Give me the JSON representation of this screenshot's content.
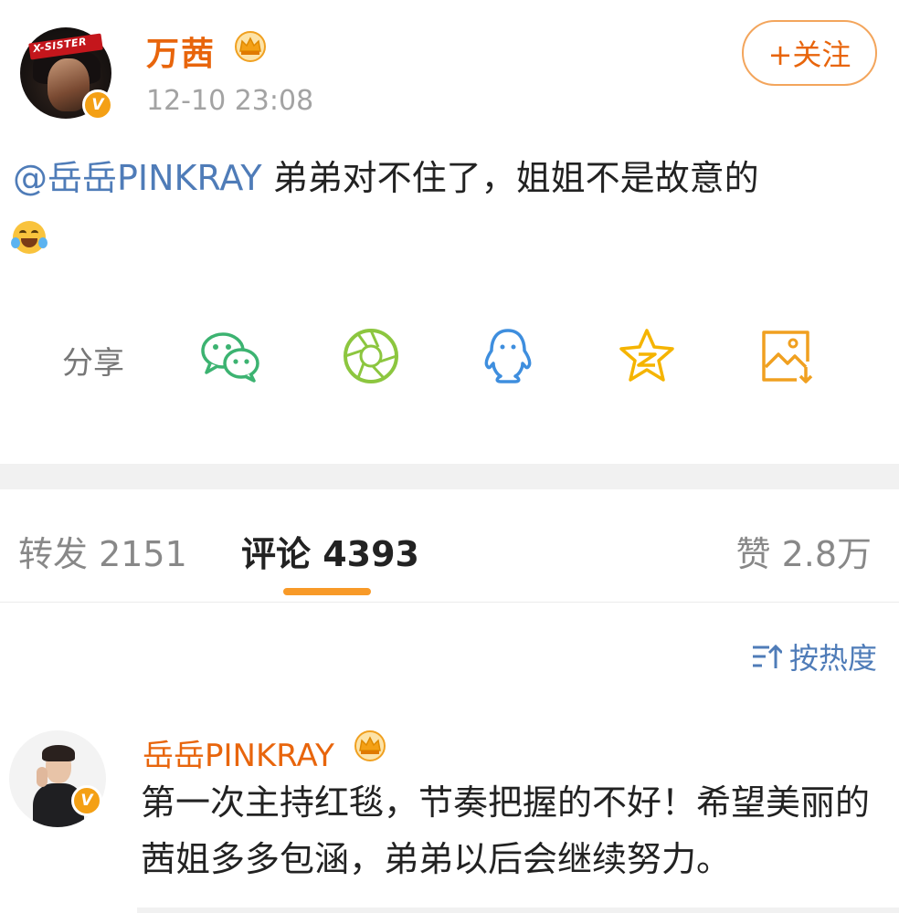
{
  "post": {
    "username": "万茜",
    "timestamp": "12-10 23:08",
    "follow_label": "+关注",
    "avatar_tag": "X-SISTER",
    "verify_badge": "V",
    "mention": "@岳岳PINKRAY",
    "text": " 弟弟对不住了，姐姐不是故意的",
    "emoji": "laughing-crying-emoji"
  },
  "share": {
    "label": "分享",
    "icons": [
      "wechat-icon",
      "moments-icon",
      "qq-icon",
      "qzone-icon",
      "save-image-icon"
    ]
  },
  "tabs": [
    {
      "label": "转发 2151"
    },
    {
      "label": "评论 4393"
    },
    {
      "label": "赞 2.8万"
    }
  ],
  "sort": {
    "label": "按热度"
  },
  "comment": {
    "username": "岳岳PINKRAY",
    "verify_badge": "V",
    "text": "第一次主持红毯，节奏把握的不好！希望美丽的茜姐多多包涵，弟弟以后会继续努力。"
  },
  "colors": {
    "accent": "#e8650c",
    "link": "#4f7cb8",
    "verify": "#f4a015",
    "indicator": "#f89a28",
    "wechat": "#3cb371",
    "moments": "#8cc63f",
    "qq": "#3e8ede",
    "qzone": "#f5b400",
    "save": "#f0a020"
  }
}
